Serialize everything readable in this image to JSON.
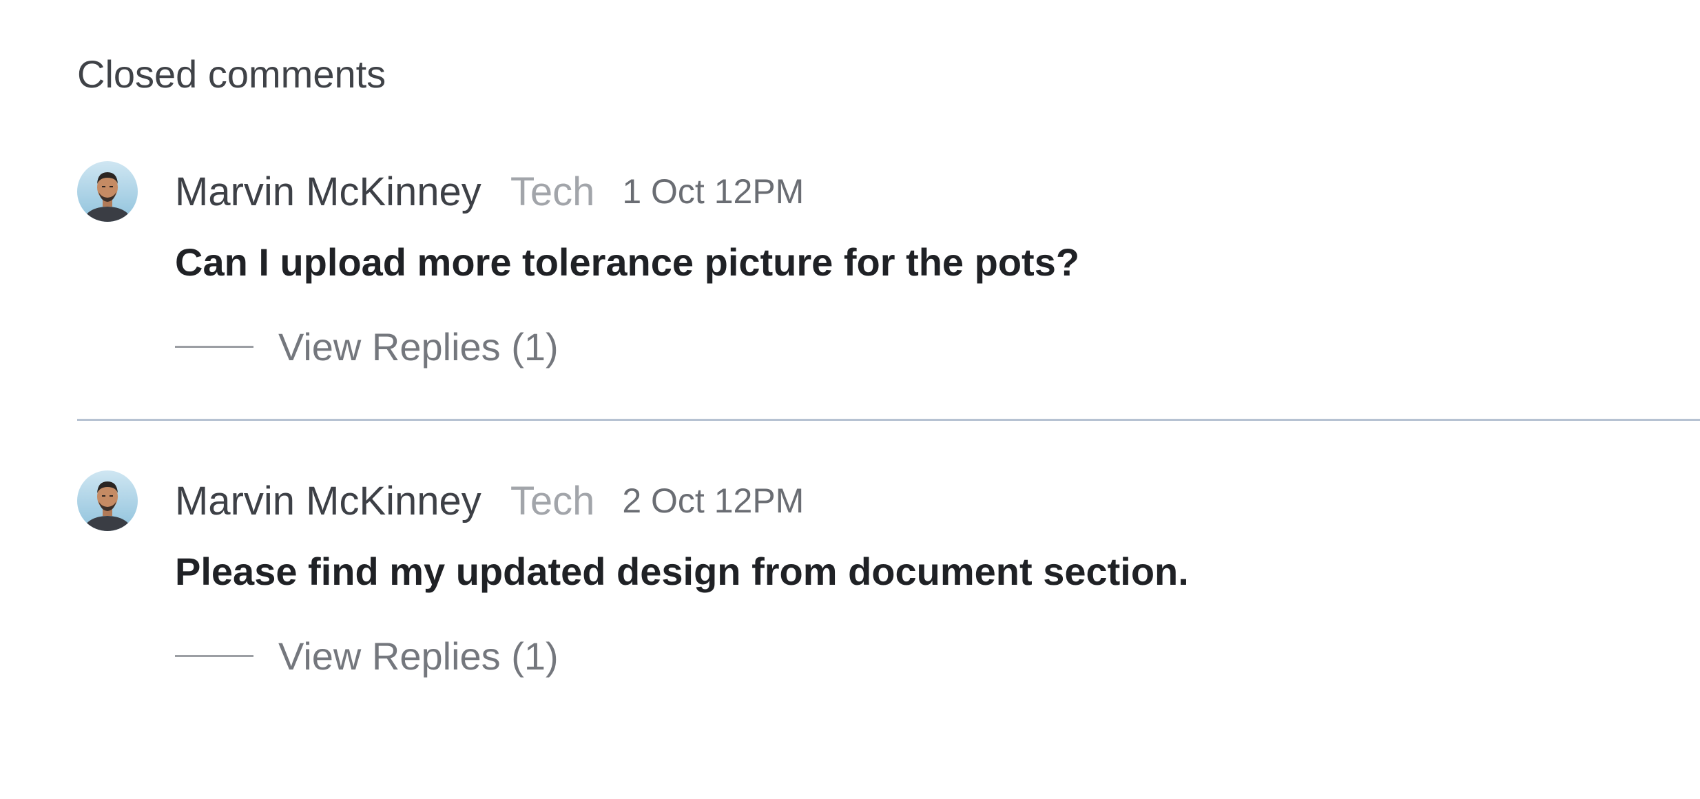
{
  "section": {
    "title": "Closed comments"
  },
  "comments": [
    {
      "author": "Marvin McKinney",
      "role": "Tech",
      "time": "1 Oct 12PM",
      "text": "Can I upload more tolerance picture for the pots?",
      "replies_label": "View Replies (1)",
      "avatar_icon": "user-avatar-icon"
    },
    {
      "author": "Marvin McKinney",
      "role": "Tech",
      "time": "2 Oct 12PM",
      "text": "Please find my updated design from document section.",
      "replies_label": "View Replies (1)",
      "avatar_icon": "user-avatar-icon"
    }
  ],
  "colors": {
    "divider": "#b6c2d2",
    "text_primary": "#1f2125",
    "text_muted": "#a2a5aa"
  }
}
